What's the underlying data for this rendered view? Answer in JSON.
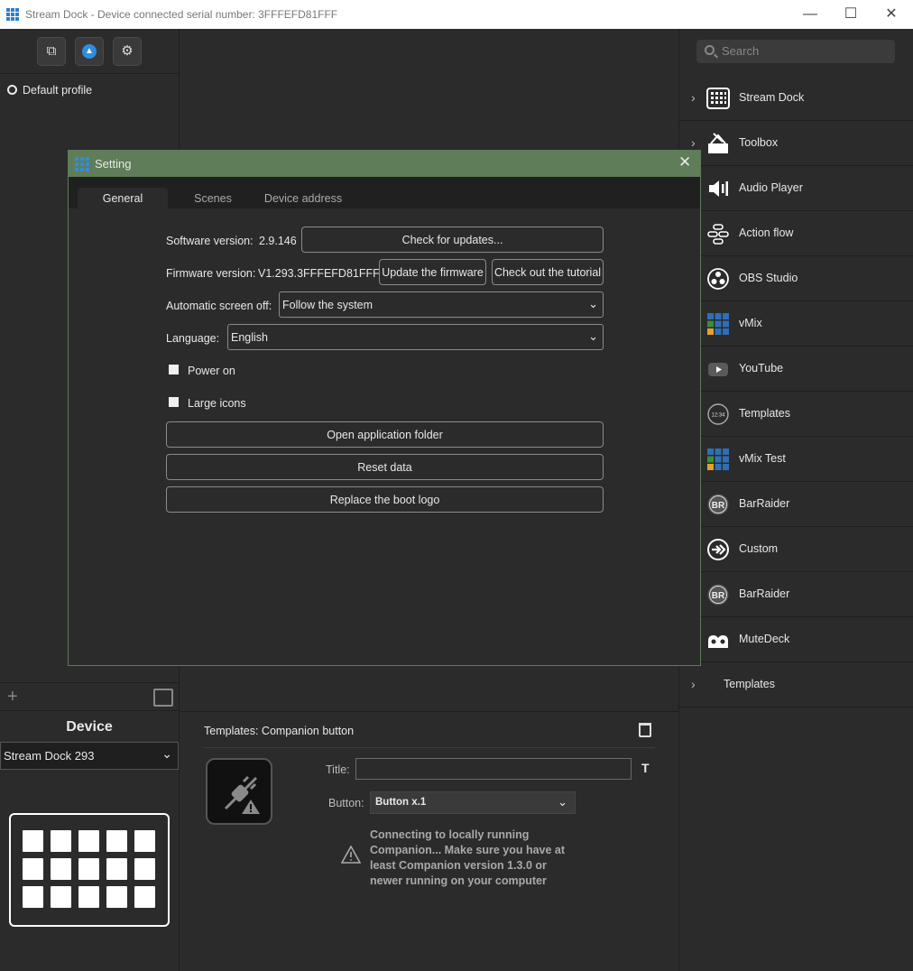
{
  "window": {
    "title": "Stream Dock - Device connected serial number: 3FFFEFD81FFF"
  },
  "left": {
    "profiles": [
      "Default profile"
    ],
    "device_title": "Device",
    "device_select": "Stream Dock 293"
  },
  "properties": {
    "header": "Templates: Companion button",
    "title_label": "Title:",
    "title_value": "",
    "title_T": "T",
    "button_label": "Button:",
    "button_value": "Button x.1",
    "warning": "Connecting to locally running Companion... Make sure you have at least Companion version 1.3.0 or newer running on your computer"
  },
  "right": {
    "search_placeholder": "Search",
    "categories": [
      {
        "name": "Stream Dock",
        "icon": "grid-icon",
        "expandable": true
      },
      {
        "name": "Toolbox",
        "icon": "toolbox-icon",
        "expandable": true
      },
      {
        "name": "Audio Player",
        "icon": "speaker-icon"
      },
      {
        "name": "Action flow",
        "icon": "action-flow-icon"
      },
      {
        "name": "OBS Studio",
        "icon": "obs-icon"
      },
      {
        "name": "vMix",
        "icon": "vmix-icon"
      },
      {
        "name": "YouTube",
        "icon": "youtube-icon"
      },
      {
        "name": "Templates",
        "icon": "clock-icon"
      },
      {
        "name": "vMix Test",
        "icon": "vmix-icon"
      },
      {
        "name": "BarRaider",
        "icon": "barraider-icon"
      },
      {
        "name": "Custom",
        "icon": "custom-icon"
      },
      {
        "name": "BarRaider",
        "icon": "barraider-icon"
      },
      {
        "name": "MuteDeck",
        "icon": "mutedeck-icon"
      },
      {
        "name": "Templates",
        "icon": "",
        "expandable": true
      }
    ]
  },
  "dialog": {
    "title": "Setting",
    "tabs": [
      "General",
      "Scenes",
      "Device address"
    ],
    "software_label": "Software version:",
    "software_value": "2.9.146",
    "check_updates": "Check for updates...",
    "firmware_label": "Firmware version:",
    "firmware_value": "V1.293.3FFFEFD81FFF",
    "update_firmware": "Update the firmware",
    "tutorial": "Check out the tutorial",
    "screen_off_label": "Automatic screen off:",
    "screen_off_value": "Follow the system",
    "language_label": "Language:",
    "language_value": "English",
    "power_on": "Power on",
    "large_icons": "Large icons",
    "open_folder": "Open application folder",
    "reset_data": "Reset data",
    "replace_logo": "Replace the boot logo"
  },
  "colors": {
    "accent": "#2e8fe0",
    "dialog_title_bg": "#5f7d58"
  }
}
